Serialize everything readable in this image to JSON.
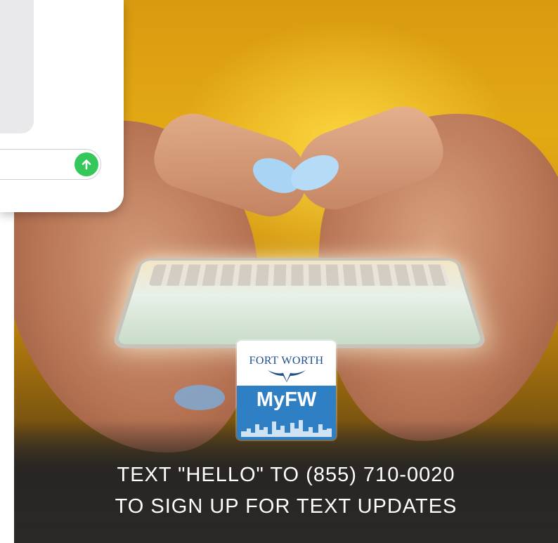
{
  "message_ui": {
    "input_placeholder": "",
    "send_icon": "arrow-up-icon",
    "send_color": "#34c759"
  },
  "logo": {
    "city_name": "FORT WORTH",
    "app_name": "MyFW",
    "bg_color": "#2f7fc4",
    "icon": "longhorn-icon"
  },
  "headline": {
    "line1": "TEXT \"HELLO\" TO (855) 710-0020",
    "line2": "TO SIGN UP FOR TEXT UPDATES"
  }
}
